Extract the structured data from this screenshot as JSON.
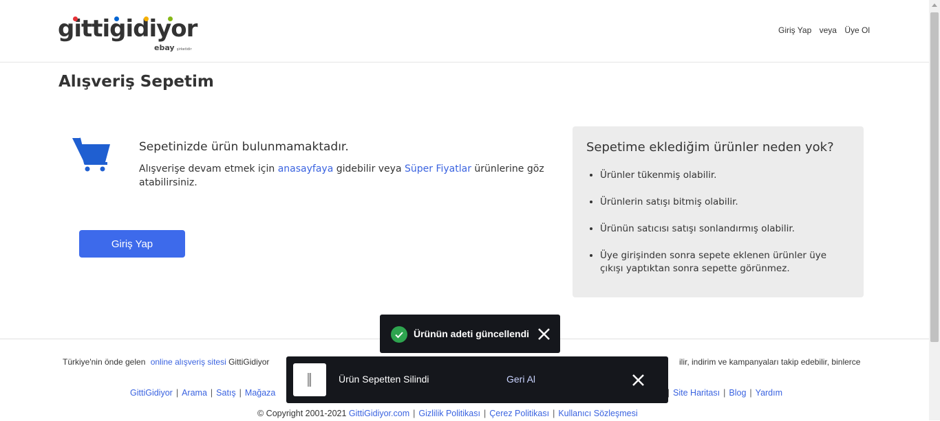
{
  "header": {
    "logo_text": "gittigidiyor",
    "logo_sub_brand": "ebay",
    "logo_sub_tag": "şirketidir",
    "login_label": "Giriş Yap",
    "or_label": "veya",
    "register_label": "Üye Ol"
  },
  "main": {
    "title": "Alışveriş Sepetim",
    "empty_title": "Sepetinizde ürün bulunmamaktadır.",
    "desc_prefix": "Alışverişe devam etmek için ",
    "desc_link1": "anasayfaya",
    "desc_middle": " gidebilir veya ",
    "desc_link2": "Süper Fiyatlar",
    "desc_suffix": " ürünlerine göz atabilirsiniz.",
    "login_button": "Giriş Yap"
  },
  "reasons": {
    "title": "Sepetime eklediğim ürünler neden yok?",
    "items": [
      "Ürünler tükenmiş olabilir.",
      "Ürünlerin satışı bitmiş olabilir.",
      "Ürünün satıcısı satışı sonlandırmış olabilir.",
      "Üye girişinden sonra sepete eklenen ürünler üye çıkışı yaptıktan sonra sepette görünmez."
    ]
  },
  "footer": {
    "line1_prefix": "Türkiye'nin önde gelen ",
    "line1_link": "online alışveriş sitesi",
    "line1_suffix": " GittiGidiyor",
    "line1_right": "ilir, indirim ve kampanyaları takip edebilir, binlerce",
    "links_left": [
      "GittiGidiyor",
      "Arama",
      "Satış",
      "Mağaza"
    ],
    "links_right_partial": "i",
    "links_right": [
      "Site Haritası",
      "Blog",
      "Yardım"
    ],
    "copyright": "© Copyright 2001-2021 ",
    "copyright_links": [
      "GittiGidiyor.com",
      "Gizlilik Politikası",
      "Çerez Politikası",
      "Kullanıcı Sözleşmesi"
    ]
  },
  "toasts": {
    "quantity_updated": "Ürünün adeti güncellendi",
    "removed": "Ürün Sepetten Silindi",
    "undo": "Geri Al"
  },
  "colors": {
    "accent": "#3d6aeb",
    "link": "#3a63e0",
    "toast_bg": "#15171c",
    "success": "#2ea44f",
    "logo_dots": [
      "#e53238",
      "#0064d2",
      "#f5af02",
      "#86b817"
    ]
  }
}
